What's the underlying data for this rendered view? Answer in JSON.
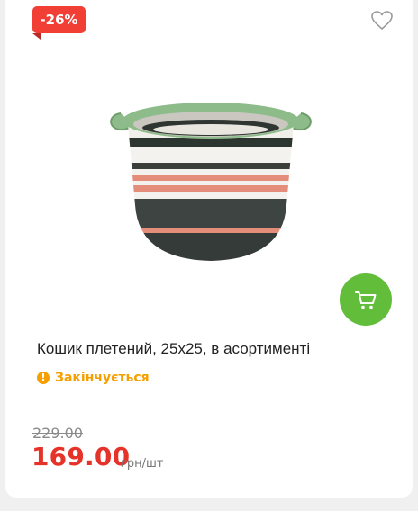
{
  "badge": {
    "discount": "-26%"
  },
  "product": {
    "title": "Кошик плетений, 25x25, в асортименті",
    "stock_status": "Закінчується",
    "old_price": "229.00",
    "price": "169.00",
    "unit": "грн/шт"
  },
  "icons": {
    "favorite": "heart-outline-icon",
    "cart": "shopping-cart-icon",
    "stock": "exclamation-circle-icon"
  },
  "colors": {
    "discount_badge": "#f23f36",
    "cart_button": "#62bd3b",
    "stock_status": "#f5a000",
    "price": "#e63329",
    "old_price": "#8a8a8a"
  }
}
